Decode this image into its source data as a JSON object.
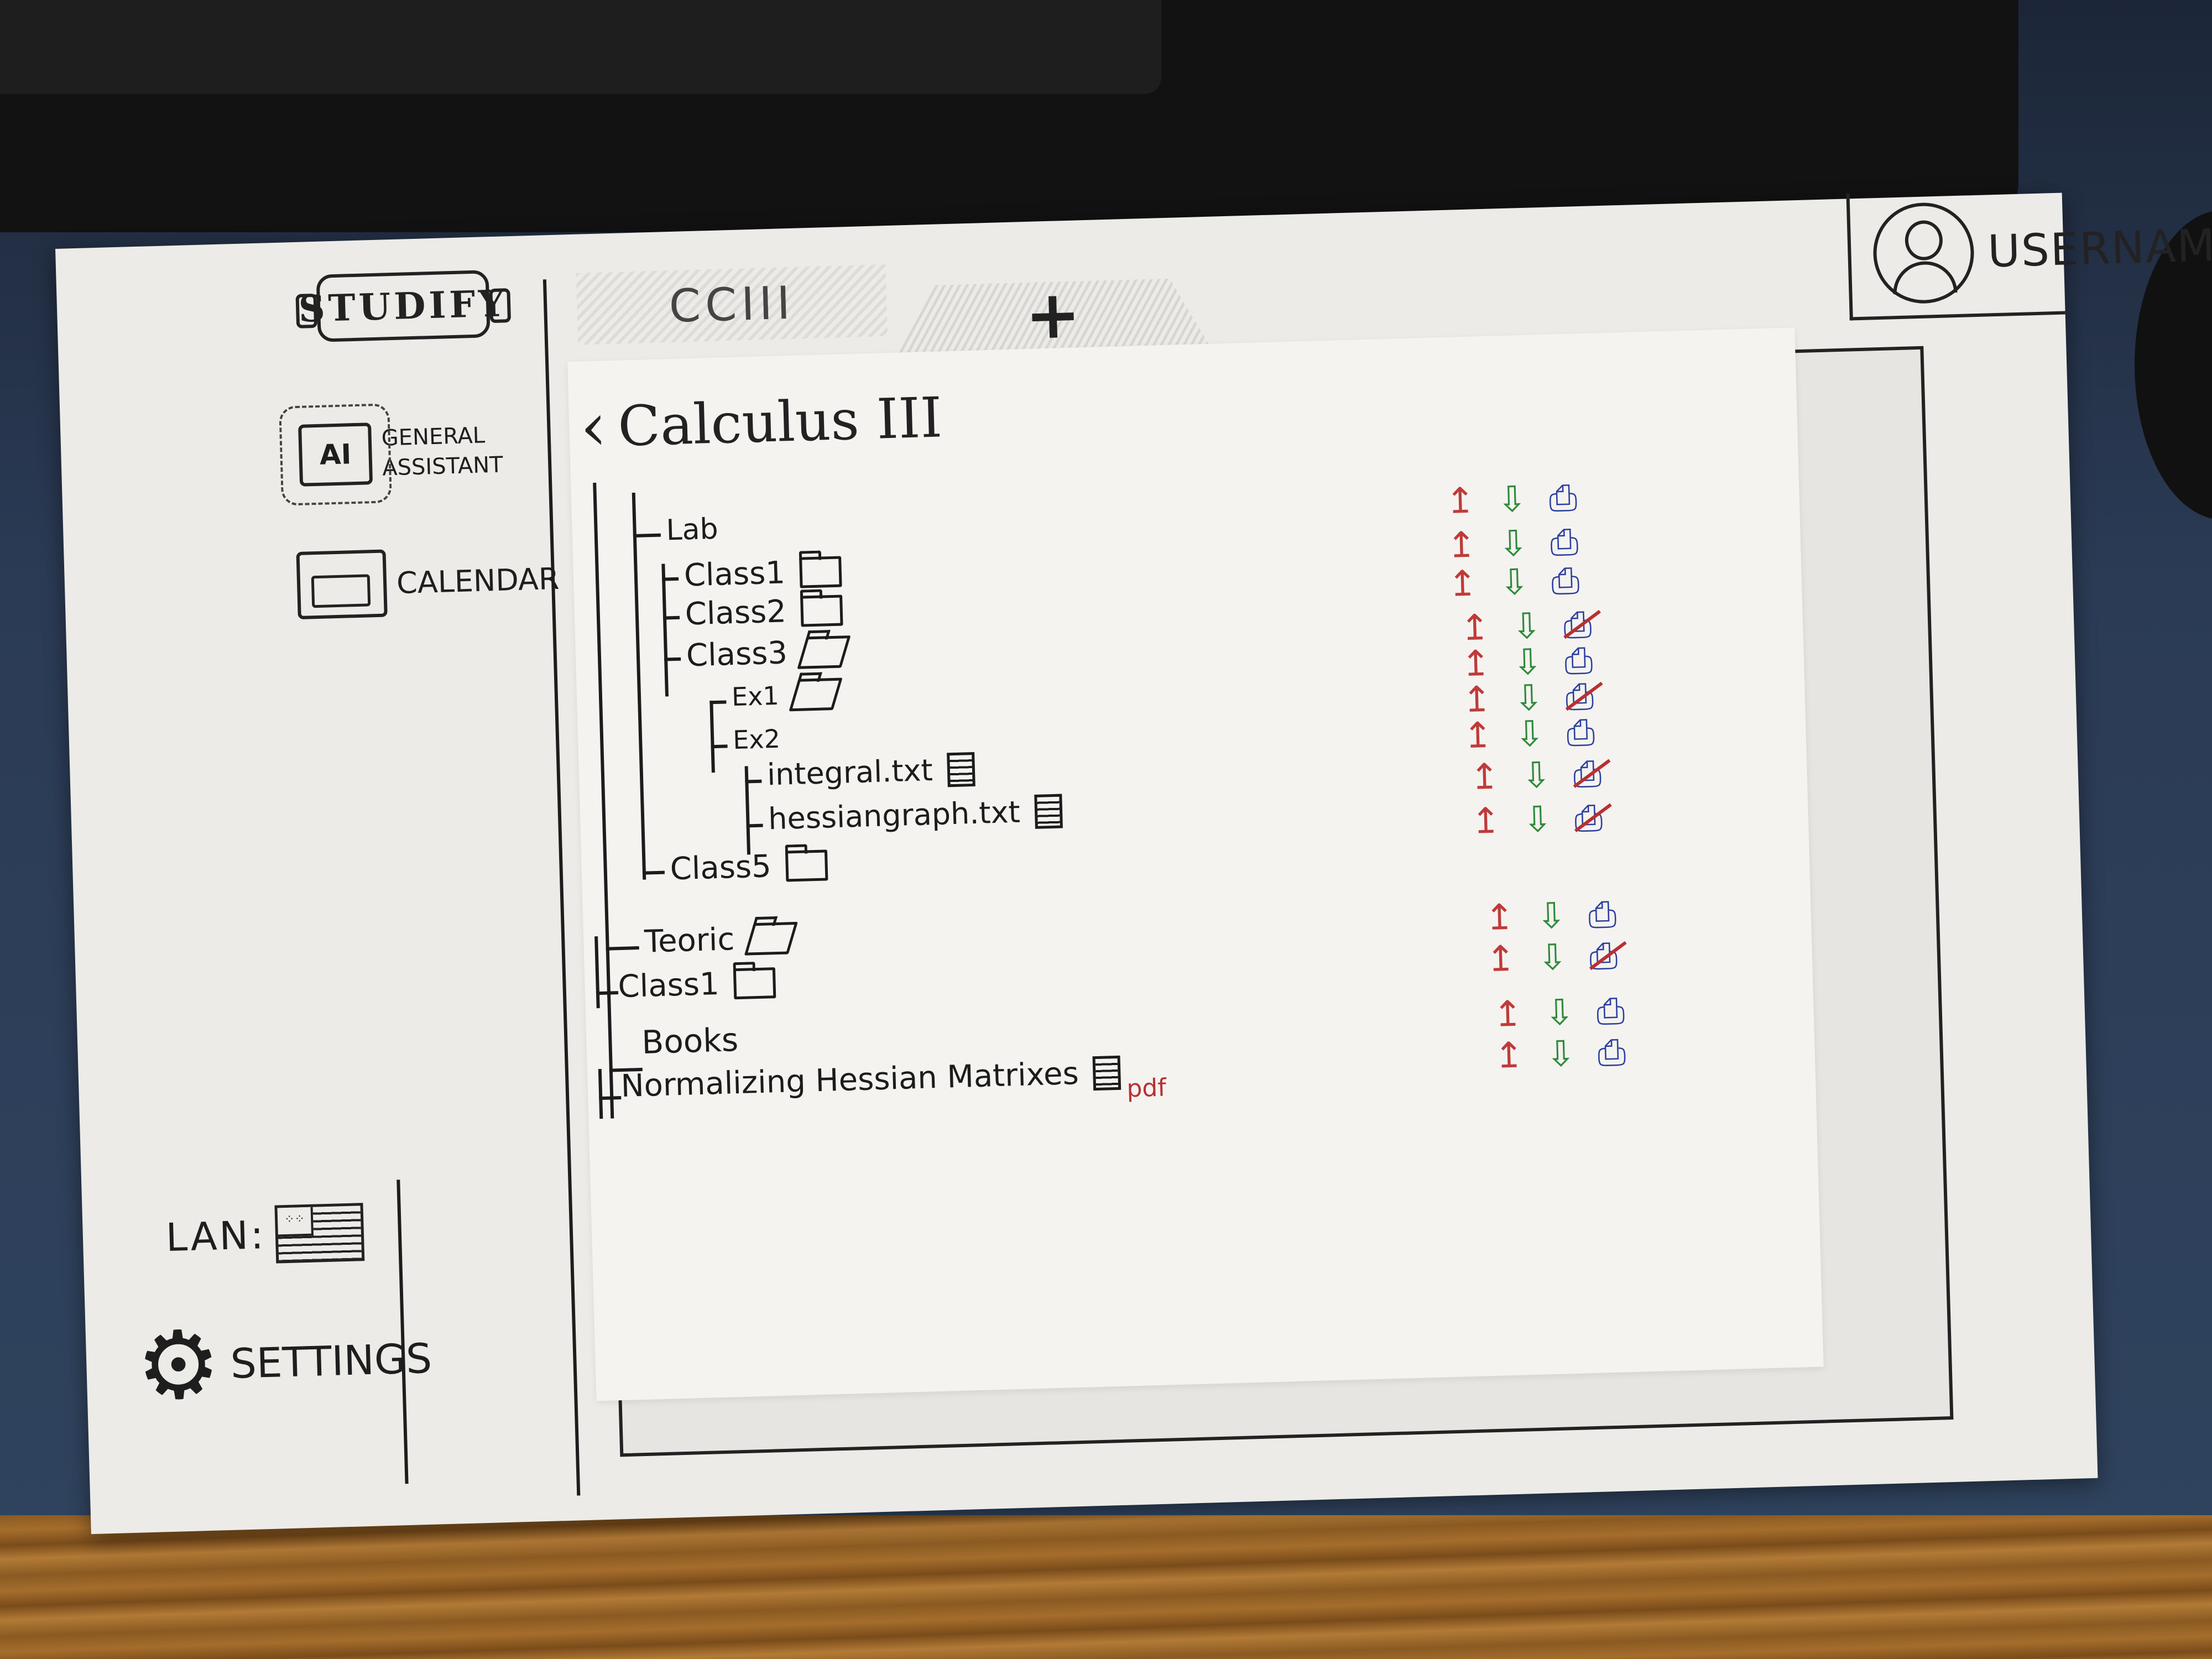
{
  "app": {
    "logo_text": "STUDIFY",
    "username": "USERNAME"
  },
  "sidebar": {
    "general_assistant": {
      "badge": "AI",
      "line1": "GENERAL",
      "line2": "ASSISTANT"
    },
    "calendar": "CALENDAR",
    "language_label": "LAN:",
    "settings": "SETTINGS"
  },
  "tabs": {
    "active": "CCIII",
    "add": "+"
  },
  "page": {
    "title": "Calculus III"
  },
  "tree": {
    "lab": "Lab",
    "lab_class1": "Class1",
    "lab_class2": "Class2",
    "lab_class3": "Class3",
    "ex1": "Ex1",
    "ex2": "Ex2",
    "file_integral": "integral.txt",
    "file_hessian_graph": "hessiangraph.txt",
    "lab_class5": "Class5",
    "teoric": "Teoric",
    "teoric_class1": "Class1",
    "books": "Books",
    "book_file": "Normalizing Hessian Matrixes",
    "book_ext": "pdf"
  },
  "icons": {
    "upload": "↥",
    "download": "⇩",
    "share": "⎙",
    "folder": "folder-icon",
    "folder_open": "folder-open-icon",
    "file": "file-icon"
  },
  "colors": {
    "upload": "#c03a3a",
    "download": "#2f8a3a",
    "share": "#2b3f9e"
  }
}
